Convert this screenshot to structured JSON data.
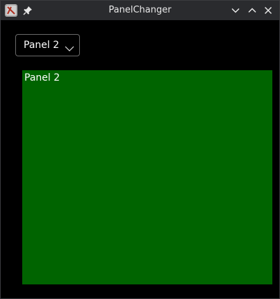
{
  "window": {
    "title": "PanelChanger"
  },
  "titlebar_icons": {
    "app": "app-icon",
    "pin": "pin-icon",
    "minimize": "chevron-down-icon",
    "maximize": "chevron-up-icon",
    "close": "close-icon"
  },
  "panel_selector": {
    "selected": "Panel 2"
  },
  "panel": {
    "label": "Panel 2",
    "background_color": "#006400"
  }
}
